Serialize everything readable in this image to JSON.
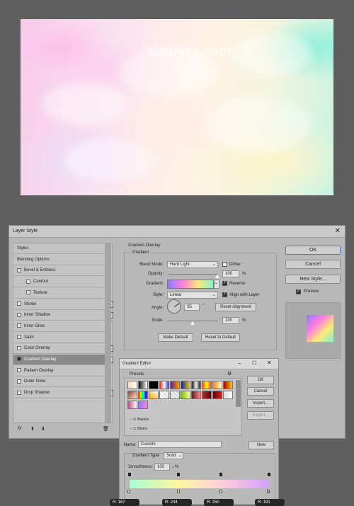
{
  "watermark": "tuhuaba.com",
  "layer_style": {
    "title": "Layer Style",
    "styles": [
      {
        "label": "Styles",
        "indent": false,
        "checkbox": false,
        "checked": false,
        "plus": false,
        "selected": false
      },
      {
        "label": "Blending Options",
        "indent": false,
        "checkbox": false,
        "checked": false,
        "plus": false,
        "selected": false
      },
      {
        "label": "Bevel & Emboss",
        "indent": false,
        "checkbox": true,
        "checked": false,
        "plus": false,
        "selected": false
      },
      {
        "label": "Contour",
        "indent": true,
        "checkbox": true,
        "checked": false,
        "plus": false,
        "selected": false
      },
      {
        "label": "Texture",
        "indent": true,
        "checkbox": true,
        "checked": false,
        "plus": false,
        "selected": false
      },
      {
        "label": "Stroke",
        "indent": false,
        "checkbox": true,
        "checked": false,
        "plus": true,
        "selected": false
      },
      {
        "label": "Inner Shadow",
        "indent": false,
        "checkbox": true,
        "checked": false,
        "plus": true,
        "selected": false
      },
      {
        "label": "Inner Glow",
        "indent": false,
        "checkbox": true,
        "checked": false,
        "plus": false,
        "selected": false
      },
      {
        "label": "Satin",
        "indent": false,
        "checkbox": true,
        "checked": false,
        "plus": false,
        "selected": false
      },
      {
        "label": "Color Overlay",
        "indent": false,
        "checkbox": true,
        "checked": false,
        "plus": true,
        "selected": false
      },
      {
        "label": "Gradient Overlay",
        "indent": false,
        "checkbox": true,
        "checked": true,
        "plus": true,
        "selected": true
      },
      {
        "label": "Pattern Overlay",
        "indent": false,
        "checkbox": true,
        "checked": false,
        "plus": false,
        "selected": false
      },
      {
        "label": "Outer Glow",
        "indent": false,
        "checkbox": true,
        "checked": false,
        "plus": false,
        "selected": false
      },
      {
        "label": "Drop Shadow",
        "indent": false,
        "checkbox": true,
        "checked": false,
        "plus": true,
        "selected": false
      }
    ],
    "fx_label": "fx",
    "section_title": "Gradient Overlay",
    "group_title": "Gradient",
    "blend_mode_label": "Blend Mode:",
    "blend_mode": "Hard Light",
    "dither_label": "Dither",
    "opacity_label": "Opacity:",
    "opacity": "100",
    "opacity_pct": 1.0,
    "gradient_label": "Gradient:",
    "reverse_label": "Reverse",
    "style_label": "Style:",
    "style": "Linear",
    "align_label": "Align with Layer",
    "angle_label": "Angle:",
    "angle": "35",
    "reset_align": "Reset Alignment",
    "scale_label": "Scale:",
    "scale": "100",
    "scale_pct": 0.5,
    "percent": "%",
    "degree": "°",
    "make_default": "Make Default",
    "reset_default": "Reset to Default",
    "ok": "OK",
    "cancel": "Cancel",
    "new_style": "New Style...",
    "preview_label": "Preview"
  },
  "gradient_editor": {
    "title": "Gradient Editor",
    "presets_label": "Presets",
    "folder1": "Basics",
    "folder2": "Blues",
    "ok": "OK",
    "cancel": "Cancel",
    "import": "Import...",
    "export": "Export...",
    "name_label": "Name:",
    "name_value": "Custom",
    "new": "New",
    "type_label": "Gradient Type:",
    "type_value": "Solid",
    "smooth_label": "Smoothness:",
    "smooth_value": "100",
    "percent": "%"
  },
  "bottom_labels": [
    "R: 167",
    "R: 244",
    "R: 250",
    "R: 191"
  ]
}
